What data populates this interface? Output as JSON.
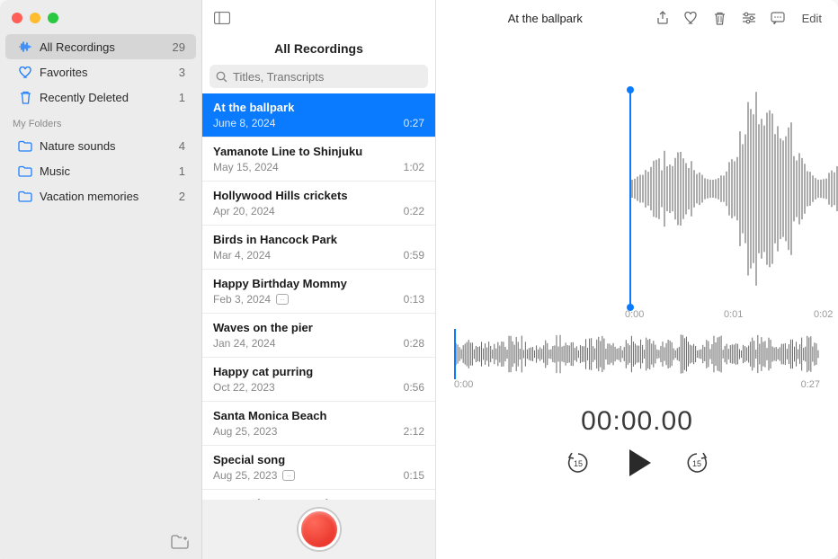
{
  "sidebar": {
    "builtin": [
      {
        "icon": "waveform",
        "label": "All Recordings",
        "count": "29",
        "selected": true
      },
      {
        "icon": "heart",
        "label": "Favorites",
        "count": "3",
        "selected": false
      },
      {
        "icon": "trash",
        "label": "Recently Deleted",
        "count": "1",
        "selected": false
      }
    ],
    "folders_header": "My Folders",
    "folders": [
      {
        "icon": "folder",
        "label": "Nature sounds",
        "count": "4"
      },
      {
        "icon": "folder",
        "label": "Music",
        "count": "1"
      },
      {
        "icon": "folder",
        "label": "Vacation memories",
        "count": "2"
      }
    ]
  },
  "middle": {
    "title": "All Recordings",
    "search_placeholder": "Titles, Transcripts",
    "recordings": [
      {
        "title": "At the ballpark",
        "date": "June 8, 2024",
        "duration": "0:27",
        "selected": true,
        "transcript": false
      },
      {
        "title": "Yamanote Line to Shinjuku",
        "date": "May 15, 2024",
        "duration": "1:02",
        "transcript": false
      },
      {
        "title": "Hollywood Hills crickets",
        "date": "Apr 20, 2024",
        "duration": "0:22",
        "transcript": false
      },
      {
        "title": "Birds in Hancock Park",
        "date": "Mar 4, 2024",
        "duration": "0:59",
        "transcript": false
      },
      {
        "title": "Happy Birthday Mommy",
        "date": "Feb 3, 2024",
        "duration": "0:13",
        "transcript": true
      },
      {
        "title": "Waves on the pier",
        "date": "Jan 24, 2024",
        "duration": "0:28",
        "transcript": false
      },
      {
        "title": "Happy cat purring",
        "date": "Oct 22, 2023",
        "duration": "0:56",
        "transcript": false
      },
      {
        "title": "Santa Monica Beach",
        "date": "Aug 25, 2023",
        "duration": "2:12",
        "transcript": false
      },
      {
        "title": "Special song",
        "date": "Aug 25, 2023",
        "duration": "0:15",
        "transcript": true
      },
      {
        "title": "Parrots in Buenos Aires",
        "date": "",
        "duration": "",
        "transcript": false
      }
    ]
  },
  "detail": {
    "title": "At the ballpark",
    "edit_label": "Edit",
    "timeline_marks": [
      "0:00",
      "0:01",
      "0:02"
    ],
    "mini_start": "0:00",
    "mini_end": "0:27",
    "big_time": "00:00.00",
    "skip_seconds": "15"
  }
}
